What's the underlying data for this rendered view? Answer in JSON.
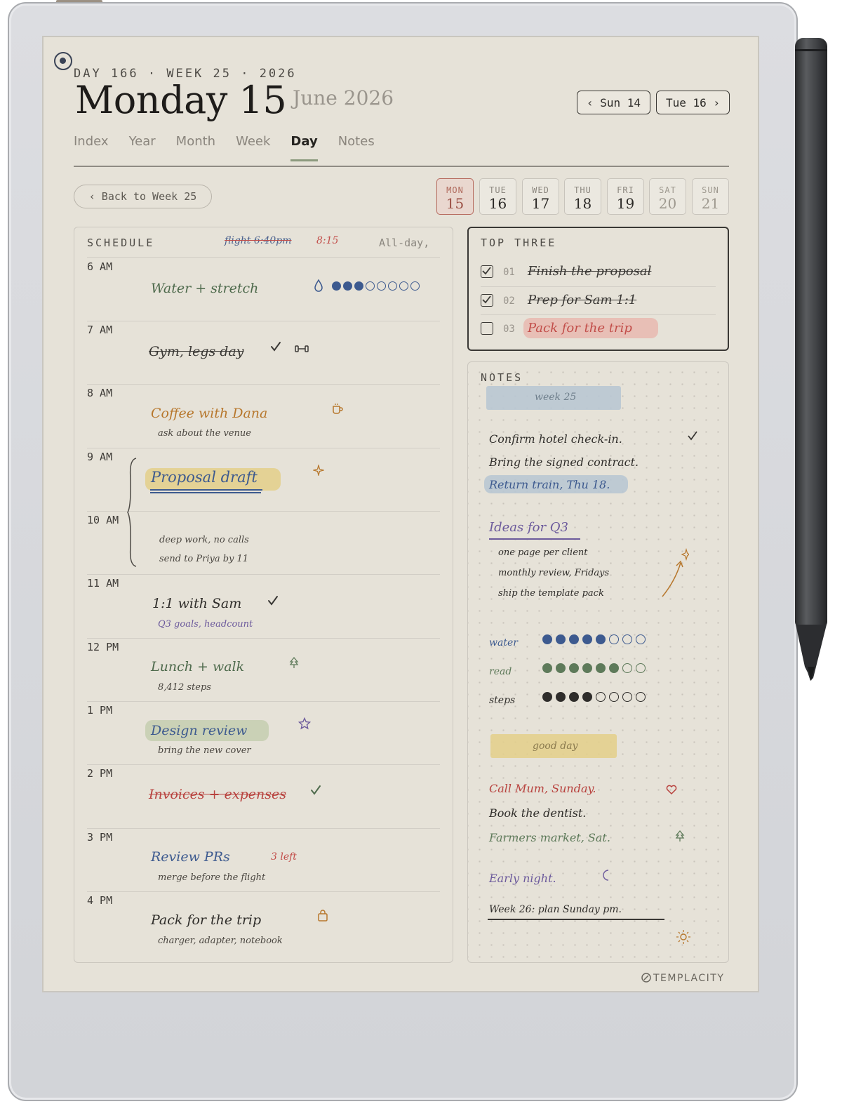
{
  "header": {
    "kicker": "DAY 166 · WEEK 25 · 2026",
    "title": "Monday 15",
    "month_year": "June 2026",
    "prev_day": "‹  Sun 14",
    "next_day": "Tue 16  ›"
  },
  "tabs": [
    {
      "label": "Index",
      "active": false
    },
    {
      "label": "Year",
      "active": false
    },
    {
      "label": "Month",
      "active": false
    },
    {
      "label": "Week",
      "active": false
    },
    {
      "label": "Day",
      "active": true
    },
    {
      "label": "Notes",
      "active": false
    }
  ],
  "back_link": "‹  Back to Week 25",
  "week_days": [
    {
      "name": "MON",
      "date": "15",
      "today": true
    },
    {
      "name": "TUE",
      "date": "16"
    },
    {
      "name": "WED",
      "date": "17"
    },
    {
      "name": "THU",
      "date": "18"
    },
    {
      "name": "FRI",
      "date": "19"
    },
    {
      "name": "SAT",
      "date": "20",
      "weekend": true
    },
    {
      "name": "SUN",
      "date": "21",
      "weekend": true
    }
  ],
  "schedule": {
    "label": "SCHEDULE",
    "flight_struck": "flight 6:40pm",
    "flight_new": "8:15",
    "all_day": "All-day,",
    "hours": [
      "6 AM",
      "7 AM",
      "8 AM",
      "9 AM",
      "10 AM",
      "11 AM",
      "12 PM",
      "1 PM",
      "2 PM",
      "3 PM",
      "4 PM"
    ],
    "entries": {
      "water": {
        "title": "Water + stretch",
        "filled": 3,
        "total": 8
      },
      "gym": {
        "title": "Gym, legs day"
      },
      "coffee": {
        "title": "Coffee with Dana",
        "sub": "ask about the venue"
      },
      "proposal": {
        "title": "Proposal draft",
        "sub1": "deep work, no calls",
        "sub2": "send to Priya by 11"
      },
      "sam": {
        "title": "1:1 with Sam",
        "sub": "Q3 goals, headcount"
      },
      "lunch": {
        "title": "Lunch + walk",
        "sub": "8,412 steps"
      },
      "design": {
        "title": "Design review",
        "sub": "bring the new cover"
      },
      "invoices": {
        "title": "Invoices + expenses"
      },
      "prs": {
        "title": "Review PRs",
        "badge": "3 left",
        "sub": "merge before the flight"
      },
      "pack": {
        "title": "Pack for the trip",
        "sub": "charger, adapter, notebook"
      }
    }
  },
  "top_three": {
    "label": "TOP THREE",
    "items": [
      {
        "num": "01",
        "text": "Finish the proposal",
        "done": true
      },
      {
        "num": "02",
        "text": "Prep for Sam 1:1",
        "done": true
      },
      {
        "num": "03",
        "text": "Pack for the trip",
        "done": false
      }
    ]
  },
  "notes": {
    "label": "NOTES",
    "tag_week": "week 25",
    "lines": [
      "Confirm hotel check-in.",
      "Bring the signed contract.",
      "Return train, Thu 18."
    ],
    "ideas_title": "Ideas for Q3",
    "ideas": [
      "one page per client",
      "monthly review, Fridays",
      "ship the template pack"
    ],
    "trackers": [
      {
        "label": "water",
        "filled": 5,
        "total": 8,
        "color": "#3d5a8f"
      },
      {
        "label": "read",
        "filled": 6,
        "total": 8,
        "color": "#5e7a5a"
      },
      {
        "label": "steps",
        "filled": 4,
        "total": 8,
        "color": "#2f2d2b"
      }
    ],
    "tag_good": "good day",
    "bottom_lines": [
      {
        "text": "Call Mum, Sunday.",
        "color": "#b8423e"
      },
      {
        "text": "Book the dentist.",
        "color": "#2f2d2a"
      },
      {
        "text": "Farmers market, Sat.",
        "color": "#5e7a5a"
      }
    ],
    "early": "Early night.",
    "week26": "Week 26: plan Sunday pm."
  },
  "brand": "TEMPLACITY",
  "colors": {
    "accent_red": "#c24e4a",
    "accent_blue": "#3d5a8f",
    "accent_green": "#5e7a5a",
    "accent_orange": "#b7772c",
    "paper": "#e6e2d8"
  }
}
